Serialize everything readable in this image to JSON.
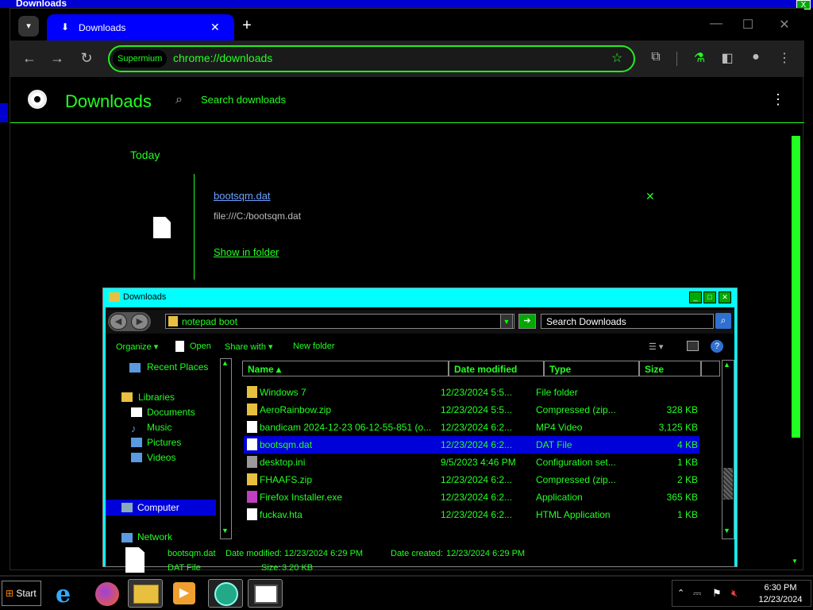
{
  "background_window": {
    "title": "Downloads",
    "close": "X"
  },
  "chrome": {
    "tab": {
      "title": "Downloads",
      "icon": "download-icon",
      "close": "✕"
    },
    "new_tab": "+",
    "window_controls": {
      "minimize": "—",
      "maximize": "☐",
      "close": "✕"
    },
    "nav": {
      "back": "←",
      "forward": "→",
      "reload": "↻"
    },
    "omnibox": {
      "chip": "Supermium",
      "url": "chrome://downloads",
      "star": "☆"
    },
    "toolbar_icons": [
      "extensions-icon",
      "labs-icon",
      "side-panel-icon",
      "profile-icon",
      "menu-icon"
    ],
    "colors": {
      "accent": "#22ff22",
      "tab": "#0000ff"
    }
  },
  "downloads_page": {
    "title": "Downloads",
    "search_placeholder": "Search downloads",
    "menu": "⋮",
    "section": "Today",
    "item": {
      "name": "bootsqm.dat",
      "path": "file:///C:/bootsqm.dat",
      "action": "Show in folder",
      "remove": "✕"
    }
  },
  "explorer": {
    "title": "Downloads",
    "address": "notepad boot",
    "search_placeholder": "Search Downloads",
    "commands": {
      "organize": "Organize ▾",
      "open": "Open",
      "share": "Share with ▾",
      "new_folder": "New folder"
    },
    "sidebar": {
      "recent": "Recent Places",
      "libraries": "Libraries",
      "documents": "Documents",
      "music": "Music",
      "pictures": "Pictures",
      "videos": "Videos",
      "computer": "Computer",
      "network": "Network"
    },
    "columns": {
      "name": "Name",
      "date": "Date modified",
      "type": "Type",
      "size": "Size"
    },
    "files": [
      {
        "name": "Windows 7",
        "date": "12/23/2024 5:5...",
        "type": "File folder",
        "size": "",
        "icon": "folder-icon",
        "color": "#e8c040"
      },
      {
        "name": "AeroRainbow.zip",
        "date": "12/23/2024 5:5...",
        "type": "Compressed (zip...",
        "size": "328 KB",
        "icon": "zip-icon",
        "color": "#e8c040"
      },
      {
        "name": "bandicam 2024-12-23 06-12-55-851 (o...",
        "date": "12/23/2024 6:2...",
        "type": "MP4 Video",
        "size": "3,125 KB",
        "icon": "video-icon",
        "color": "#ffffff"
      },
      {
        "name": "bootsqm.dat",
        "date": "12/23/2024 6:2...",
        "type": "DAT File",
        "size": "4 KB",
        "icon": "file-icon",
        "color": "#ffffff"
      },
      {
        "name": "desktop.ini",
        "date": "9/5/2023 4:46 PM",
        "type": "Configuration set...",
        "size": "1 KB",
        "icon": "settings-file-icon",
        "color": "#999999"
      },
      {
        "name": "FHAAFS.zip",
        "date": "12/23/2024 6:2...",
        "type": "Compressed (zip...",
        "size": "2 KB",
        "icon": "zip-icon",
        "color": "#e8c040"
      },
      {
        "name": "Firefox Installer.exe",
        "date": "12/23/2024 6:2...",
        "type": "Application",
        "size": "365 KB",
        "icon": "firefox-icon",
        "color": "#c040c0"
      },
      {
        "name": "fuckav.hta",
        "date": "12/23/2024 6:2...",
        "type": "HTML Application",
        "size": "1 KB",
        "icon": "hta-icon",
        "color": "#ffffff"
      }
    ],
    "details": {
      "name": "bootsqm.dat",
      "modified_label": "Date modified:",
      "modified": "12/23/2024 6:29 PM",
      "created_label": "Date created:",
      "created": "12/23/2024 6:29 PM",
      "type": "DAT File",
      "size_label": "Size:",
      "size": "3.20 KB"
    }
  },
  "taskbar": {
    "start": "Start",
    "apps": [
      "ie-icon",
      "firefox-icon",
      "explorer-icon",
      "media-player-icon",
      "chrome-icon",
      "window-icon"
    ],
    "clock_time": "6:30 PM",
    "clock_date": "12/23/2024"
  }
}
